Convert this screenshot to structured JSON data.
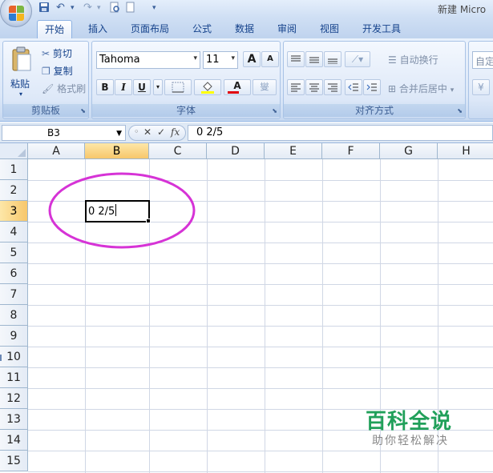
{
  "window": {
    "title": "新建 Micro",
    "qat": {
      "undo_glyph": "↶",
      "redo_glyph": "↷",
      "more_glyph": "▾"
    }
  },
  "tabs": [
    {
      "label": "开始",
      "active": true
    },
    {
      "label": "插入"
    },
    {
      "label": "页面布局"
    },
    {
      "label": "公式"
    },
    {
      "label": "数据"
    },
    {
      "label": "审阅"
    },
    {
      "label": "视图"
    },
    {
      "label": "开发工具"
    }
  ],
  "ribbon": {
    "clipboard": {
      "label": "剪贴板",
      "paste": "粘贴",
      "cut": "剪切",
      "copy": "复制",
      "format_painter": "格式刷"
    },
    "font": {
      "label": "字体",
      "font_name": "Tahoma",
      "font_size": "11",
      "grow": "A",
      "shrink": "A",
      "bold": "B",
      "italic": "I",
      "underline": "U",
      "font_color_glyph": "A",
      "phonetic": "燮",
      "font_color": "#e0000a",
      "fill_color": "#ffff00"
    },
    "alignment": {
      "label": "对齐方式",
      "wrap_text": "自动换行",
      "merge_center": "合并后居中"
    },
    "number": {
      "format": "自定"
    }
  },
  "formula_bar": {
    "name_box": "B3",
    "fx": "fx",
    "cancel": "✕",
    "enter": "✓",
    "content": "0 2/5"
  },
  "sheet": {
    "columns": [
      "A",
      "B",
      "C",
      "D",
      "E",
      "F",
      "G",
      "H"
    ],
    "rows": [
      "1",
      "2",
      "3",
      "4",
      "5",
      "6",
      "7",
      "8",
      "9",
      "10",
      "11",
      "12",
      "13",
      "14",
      "15"
    ],
    "selected_column": "B",
    "selected_row": "3",
    "active_cell_value": "0 2/5",
    "annotation_color": "#d633d6"
  },
  "watermark": {
    "title": "百科全说",
    "subtitle": "助你轻松解决"
  }
}
